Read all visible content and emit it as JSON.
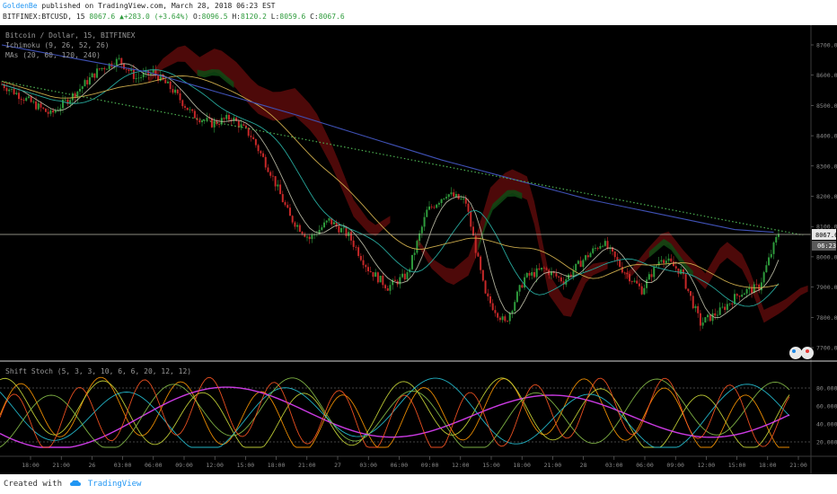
{
  "header": {
    "author": "GoldenBe",
    "published": "published on TradingView.com, March 28, 2018 06:23 EST",
    "symbol": "BITFINEX:BTCUSD, 15",
    "last": "8067.6",
    "change": "+283.0 (+3.64%)",
    "o_label": "O:",
    "o": "8096.5",
    "h_label": "H:",
    "h": "8120.2",
    "l_label": "L:",
    "l": "8059.6",
    "c_label": "C:",
    "c": "8067.6"
  },
  "legend": {
    "title": "Bitcoin / Dollar, 15, BITFINEX",
    "ichimoku": "Ichimoku (9, 26, 52, 26)",
    "mas": "MAs (20, 60, 120, 240)",
    "stoch": "Shift Stoch (5, 3, 3, 10, 6, 6, 20, 12, 12)"
  },
  "price_axis": {
    "ticks": [
      "8700.0",
      "8600.0",
      "8500.0",
      "8400.0",
      "8300.0",
      "8200.0",
      "8100.0",
      "8000.0",
      "7900.0",
      "7800.0",
      "7700.0"
    ],
    "last_price_label": "8067.6",
    "countdown_label": "06:23"
  },
  "stoch_axis": {
    "ticks": [
      "80.0000",
      "60.0000",
      "40.0000",
      "20.0000"
    ]
  },
  "time_axis": {
    "labels": [
      "18:00",
      "21:00",
      "26",
      "03:00",
      "06:00",
      "09:00",
      "12:00",
      "15:00",
      "18:00",
      "21:00",
      "27",
      "03:00",
      "06:00",
      "09:00",
      "12:00",
      "15:00",
      "18:00",
      "21:00",
      "28",
      "03:00",
      "06:00",
      "09:00",
      "12:00",
      "15:00",
      "18:00",
      "21:00"
    ]
  },
  "footer": {
    "created": "Created with",
    "brand": "TradingView"
  },
  "colors": {
    "background": "#000000",
    "candle_up": "#2e9b3c",
    "candle_down": "#c62828",
    "cloud_bear": "#5a0a0a",
    "cloud_bull": "#0f4a14",
    "ma20": "#d9d9c0",
    "ma60": "#26a69a",
    "ma120": "#c8a84a",
    "ma240": "#3f51b5",
    "dotted_ma": "#4caf50",
    "stoch_colors": [
      "#ff9800",
      "#cddc39",
      "#26c6da",
      "#e040fb",
      "#8bc34a",
      "#ff5722"
    ]
  },
  "chart_data": {
    "type": "line",
    "title": "Bitcoin / Dollar, 15, BITFINEX",
    "price_ylim": [
      7680,
      8770
    ],
    "x_index_range": [
      0,
      300
    ],
    "close_points": [
      [
        0,
        8570
      ],
      [
        10,
        8520
      ],
      [
        20,
        8470
      ],
      [
        30,
        8540
      ],
      [
        40,
        8620
      ],
      [
        48,
        8650
      ],
      [
        55,
        8590
      ],
      [
        62,
        8610
      ],
      [
        70,
        8550
      ],
      [
        78,
        8470
      ],
      [
        86,
        8440
      ],
      [
        94,
        8460
      ],
      [
        102,
        8400
      ],
      [
        110,
        8280
      ],
      [
        118,
        8130
      ],
      [
        126,
        8060
      ],
      [
        134,
        8120
      ],
      [
        142,
        8070
      ],
      [
        150,
        7960
      ],
      [
        158,
        7900
      ],
      [
        166,
        7940
      ],
      [
        174,
        8150
      ],
      [
        182,
        8210
      ],
      [
        190,
        8180
      ],
      [
        198,
        7870
      ],
      [
        206,
        7780
      ],
      [
        214,
        7930
      ],
      [
        222,
        7960
      ],
      [
        230,
        7920
      ],
      [
        238,
        7990
      ],
      [
        246,
        8050
      ],
      [
        254,
        7960
      ],
      [
        262,
        7890
      ],
      [
        270,
        8000
      ],
      [
        278,
        7950
      ],
      [
        286,
        7780
      ],
      [
        294,
        7820
      ],
      [
        302,
        7880
      ],
      [
        310,
        7900
      ],
      [
        318,
        8080
      ]
    ],
    "ma240_points": [
      [
        0,
        8700
      ],
      [
        60,
        8610
      ],
      [
        120,
        8470
      ],
      [
        180,
        8320
      ],
      [
        240,
        8190
      ],
      [
        300,
        8090
      ],
      [
        318,
        8080
      ]
    ],
    "stoch_ylim": [
      10,
      100
    ],
    "stoch_levels": [
      80,
      20
    ]
  }
}
